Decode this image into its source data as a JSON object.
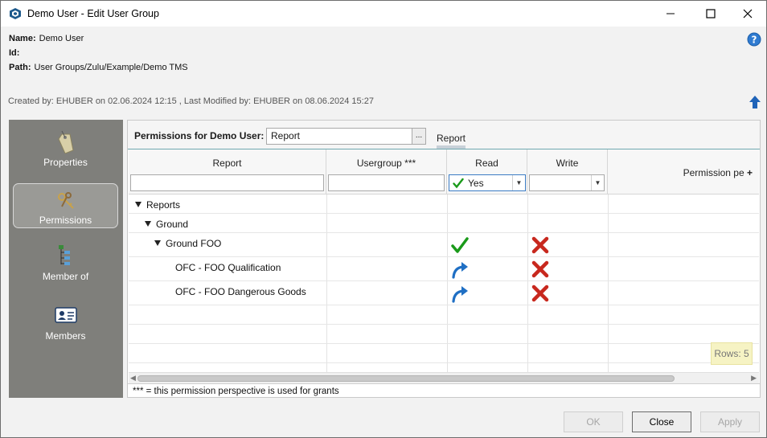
{
  "window": {
    "title": "Demo User - Edit User Group"
  },
  "info": {
    "name_label": "Name:",
    "name_value": "Demo User",
    "id_label": "Id:",
    "id_value": "",
    "path_label": "Path:",
    "path_value": "User Groups/Zulu/Example/Demo TMS",
    "created": "Created by: EHUBER on 02.06.2024 12:15 ,  Last Modified by: EHUBER on 08.06.2024 15:27"
  },
  "sidebar": {
    "items": [
      {
        "label": "Properties",
        "icon": "tag-icon",
        "active": false
      },
      {
        "label": "Permissions",
        "icon": "keys-icon",
        "active": true
      },
      {
        "label": "Member of",
        "icon": "hierarchy-icon",
        "active": false
      },
      {
        "label": "Members",
        "icon": "id-card-icon",
        "active": false
      }
    ]
  },
  "permissions": {
    "label": "Permissions for Demo User:",
    "value": "Report",
    "browse_label": "...",
    "tab_label": "Report"
  },
  "grid": {
    "columns": {
      "report": "Report",
      "usergroup": "Usergroup ***",
      "read": "Read",
      "write": "Write",
      "perspective": "Permission pe"
    },
    "read_filter": "Yes",
    "rows": [
      {
        "label": "Reports",
        "level": 0,
        "expanded": true,
        "read": "",
        "write": ""
      },
      {
        "label": "Ground",
        "level": 1,
        "expanded": true,
        "read": "",
        "write": ""
      },
      {
        "label": "Ground FOO",
        "level": 2,
        "expanded": true,
        "read": "check",
        "write": "cross"
      },
      {
        "label": "OFC - FOO Qualification",
        "level": 3,
        "expanded": false,
        "read": "inherit",
        "write": "cross"
      },
      {
        "label": "OFC - FOO Dangerous Goods",
        "level": 3,
        "expanded": false,
        "read": "inherit",
        "write": "cross"
      }
    ],
    "rows_count": "Rows: 5"
  },
  "footnote": "*** = this permission perspective is used for grants",
  "buttons": {
    "ok": "OK",
    "close": "Close",
    "apply": "Apply"
  },
  "colors": {
    "sidebar": "#7f7f7b",
    "check": "#1a9a1a",
    "cross": "#c8281e",
    "inherit": "#1f6fc4",
    "accent": "#6fa9b0"
  }
}
